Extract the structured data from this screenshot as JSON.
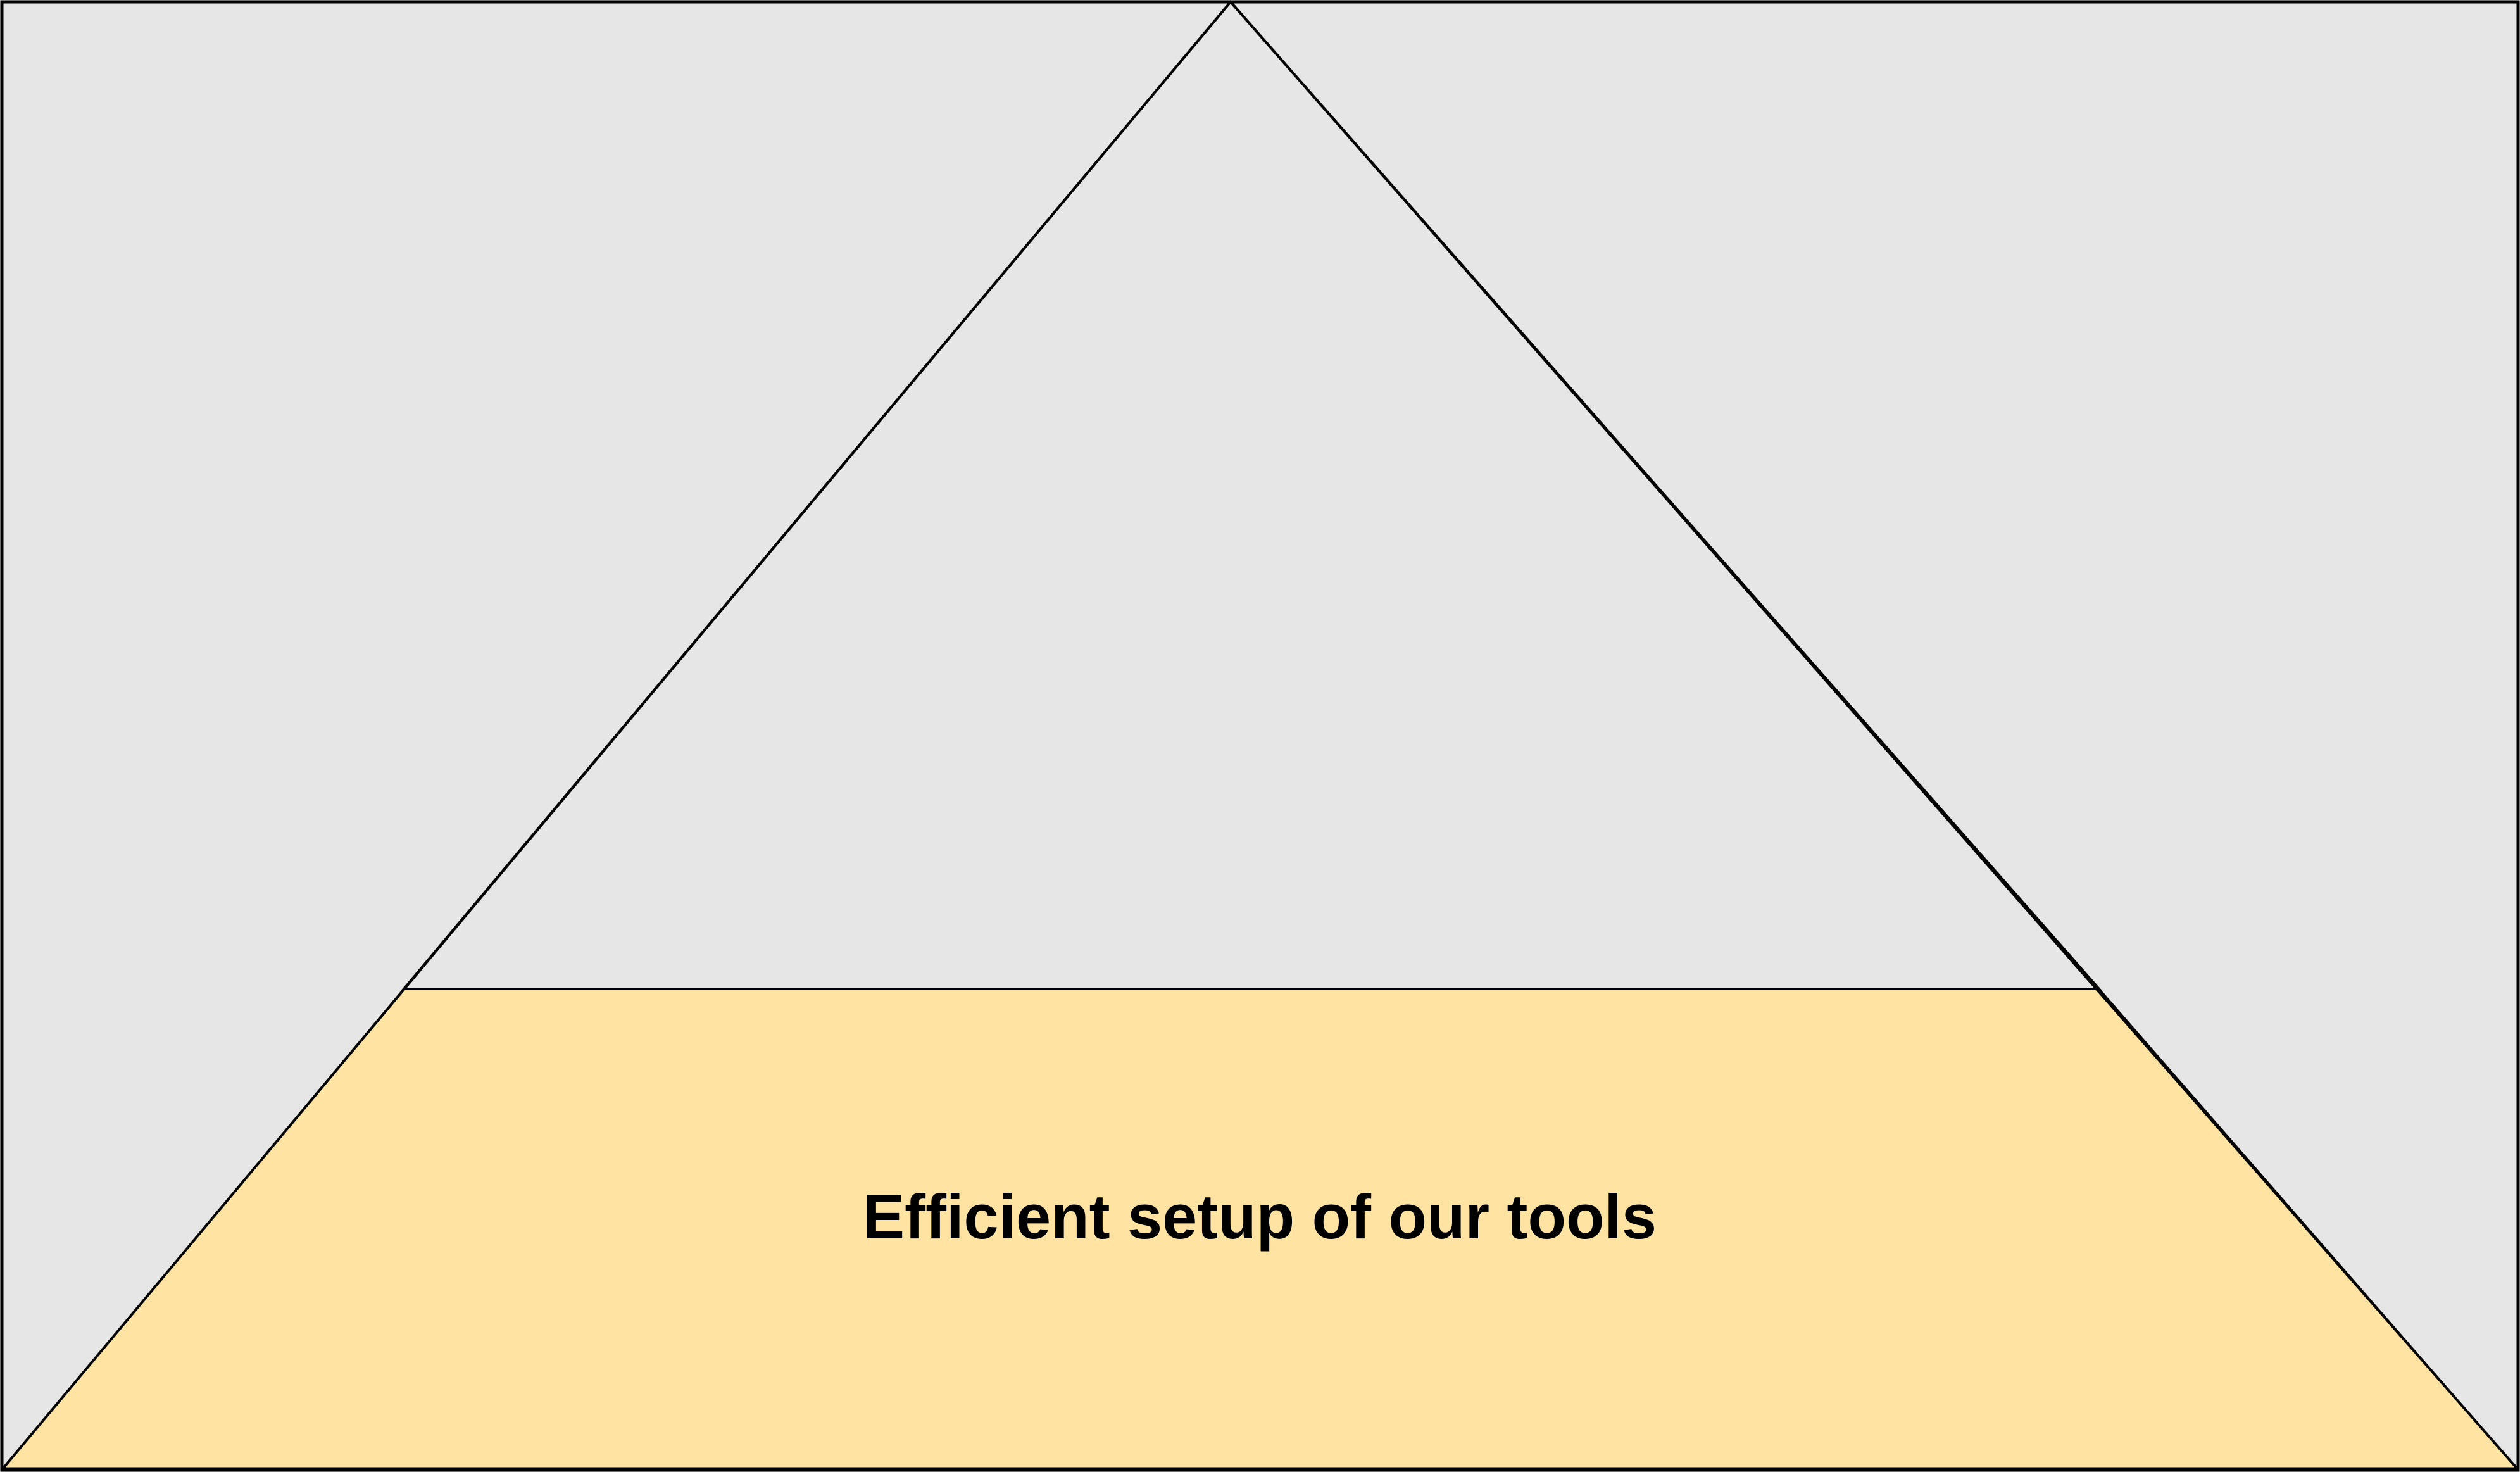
{
  "colors": {
    "background": "#e6e6e6",
    "outline": "#000000",
    "base_fill": "#ffe3a3"
  },
  "pyramid": {
    "levels": [
      {
        "label": "",
        "highlighted": false
      },
      {
        "label": "Efficient setup of our tools",
        "highlighted": true
      }
    ]
  }
}
